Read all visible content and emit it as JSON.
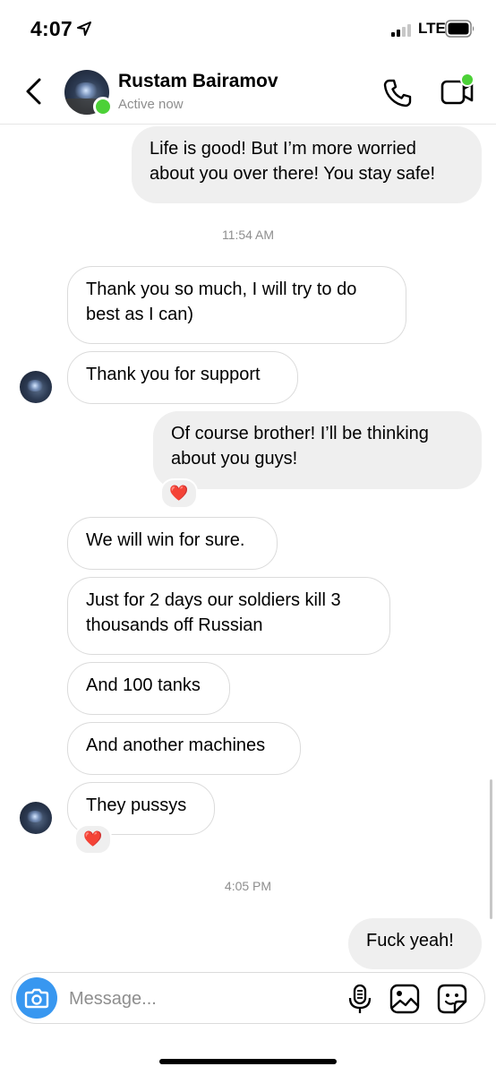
{
  "status_bar": {
    "time": "4:07",
    "network": "LTE"
  },
  "header": {
    "contact_name": "Rustam Bairamov",
    "contact_status": "Active now"
  },
  "messages": [
    {
      "text_lines": [
        "Life is good! But I’m more worried",
        "about you over there! You stay safe!"
      ]
    },
    {
      "text_lines": [
        "Thank you so much, I will try to do",
        "best as I can)"
      ]
    },
    {
      "text_lines": [
        "Thank you for support"
      ]
    },
    {
      "text_lines": [
        "Of course brother! I’ll be thinking",
        "about you guys!"
      ]
    },
    {
      "text_lines": [
        "We will win for sure."
      ]
    },
    {
      "text_lines": [
        "Just for 2 days our soldiers kill 3",
        "thousands off Russian"
      ]
    },
    {
      "text_lines": [
        "And 100 tanks"
      ]
    },
    {
      "text_lines": [
        "And another machines"
      ]
    },
    {
      "text_lines": [
        "They pussys"
      ]
    },
    {
      "text_lines": [
        "Fuck yeah!"
      ]
    }
  ],
  "timestamps": [
    "11:54 AM",
    "4:05 PM"
  ],
  "reactions": [
    "❤️",
    "❤️"
  ],
  "composer": {
    "placeholder": "Message..."
  },
  "colors": {
    "accent": "#3897f0",
    "online": "#4cd137",
    "sent_bubble": "#efefef",
    "received_border": "#dbdbdb",
    "heart": "#e0245e"
  },
  "icons": [
    "location-arrow-icon",
    "signal-icon",
    "battery-icon",
    "back-chevron-icon",
    "phone-icon",
    "video-call-icon",
    "camera-icon",
    "microphone-icon",
    "gallery-icon",
    "sticker-icon",
    "heart-reaction-icon"
  ]
}
